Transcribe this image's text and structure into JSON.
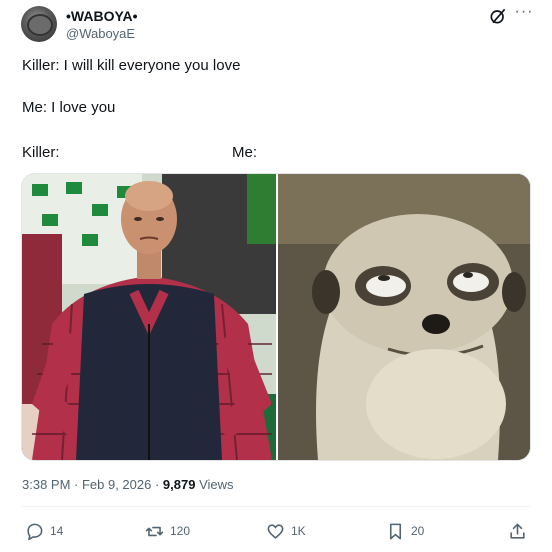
{
  "author": {
    "display_name": "•WABOYA•",
    "handle": "@WaboyaE",
    "avatar_icon": "profile-avatar"
  },
  "header_icons": [
    "grok-icon",
    "more-icon"
  ],
  "tweet_lines": [
    "Killer: I will kill everyone you love",
    "Me: I love you",
    "Killer:",
    "Me:"
  ],
  "media": {
    "left_image": "disappointed-man-photo",
    "right_image": "meerkat-photo"
  },
  "meta": {
    "time_date": "3:38 PM · Feb 9, 2026 · ",
    "views_count": "9,879",
    "views_label": " Views"
  },
  "actions": {
    "replies": "14",
    "retweets": "120",
    "likes": "1K",
    "bookmarks": "20"
  },
  "colors": {
    "text": "#0f1419",
    "secondary": "#536471"
  }
}
